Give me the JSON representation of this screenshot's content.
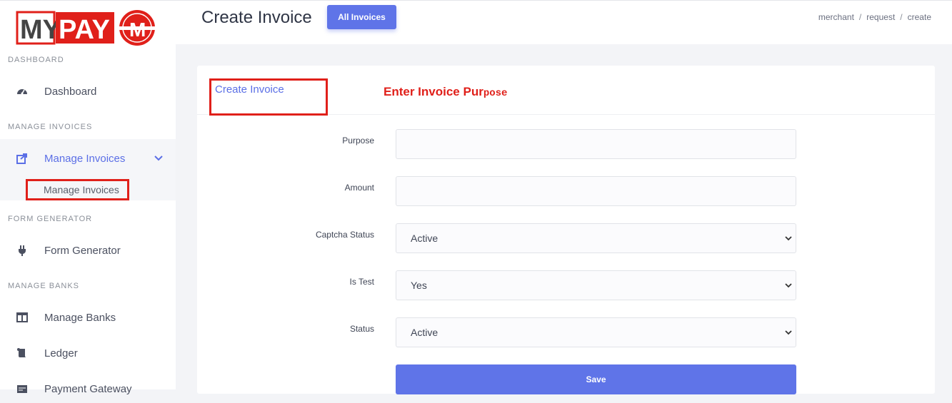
{
  "brand": {
    "logo_text": "MYPAY",
    "logo_badge": "M"
  },
  "sidebar": {
    "sections": [
      {
        "title": "DASHBOARD"
      },
      {
        "title": "MANAGE INVOICES"
      },
      {
        "title": "FORM GENERATOR"
      },
      {
        "title": "MANAGE BANKS"
      }
    ],
    "items": [
      {
        "label": "Dashboard",
        "icon": "gauge-icon"
      },
      {
        "label": "Manage Invoices",
        "icon": "share-square-icon"
      },
      {
        "label": "Manage Invoices",
        "icon": ""
      },
      {
        "label": "Form Generator",
        "icon": "plug-icon"
      },
      {
        "label": "Manage Banks",
        "icon": "columns-icon"
      },
      {
        "label": "Ledger",
        "icon": "scroll-icon"
      },
      {
        "label": "Payment Gateway",
        "icon": "card-icon"
      }
    ]
  },
  "header": {
    "title": "Create Invoice",
    "all_invoices_label": "All Invoices",
    "breadcrumb": [
      "merchant",
      "request",
      "create"
    ]
  },
  "card": {
    "title": "Create Invoice",
    "annotation_main": "Enter Invoice Pur",
    "annotation_tail": "pose"
  },
  "form": {
    "purpose": {
      "label": "Purpose",
      "value": ""
    },
    "amount": {
      "label": "Amount",
      "value": ""
    },
    "captcha_status": {
      "label": "Captcha Status",
      "value": "Active"
    },
    "is_test": {
      "label": "Is Test",
      "value": "Yes"
    },
    "status": {
      "label": "Status",
      "value": "Active"
    },
    "save_label": "Save"
  },
  "colors": {
    "accent": "#5f74e8",
    "annotation": "#e0201a"
  }
}
